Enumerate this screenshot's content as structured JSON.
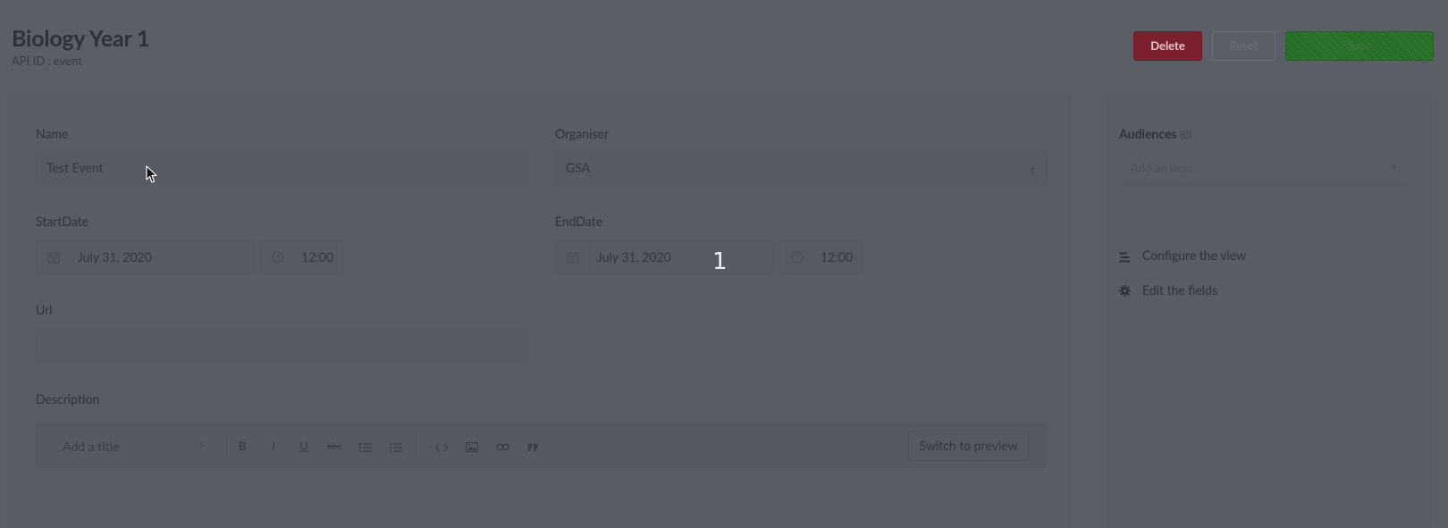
{
  "header": {
    "title": "Biology Year 1",
    "api_id": "API ID : event",
    "delete_label": "Delete",
    "reset_label": "Reset",
    "save_label": "Save"
  },
  "form": {
    "name": {
      "label": "Name",
      "value": "Test Event"
    },
    "organiser": {
      "label": "Organiser",
      "value": "GSA"
    },
    "start": {
      "label": "StartDate",
      "date": "July 31, 2020",
      "time": "12:00"
    },
    "end": {
      "label": "EndDate",
      "date": "July 31, 2020",
      "time": "12:00"
    },
    "url": {
      "label": "Url",
      "value": ""
    },
    "description": {
      "label": "Description",
      "heading_select": "Add a title",
      "toolbar": {
        "bold": "B",
        "italic": "I",
        "underline": "U",
        "strike": "abc"
      },
      "switch_label": "Switch to preview"
    }
  },
  "sidebar": {
    "audiences_label": "Audiences",
    "audiences_count": "(0)",
    "audiences_placeholder": "Add an item...",
    "configure_label": "Configure the view",
    "edit_fields_label": "Edit the fields"
  },
  "overlay": {
    "step_number": "1"
  },
  "icons": {
    "calendar": "calendar-icon",
    "clock": "clock-icon",
    "list": "list-icon",
    "gear": "gear-icon",
    "cursor": "mouse-pointer-icon"
  }
}
